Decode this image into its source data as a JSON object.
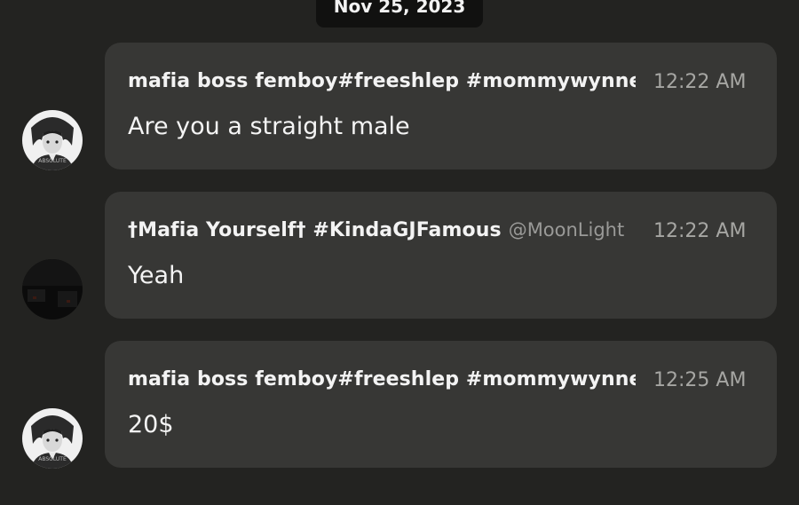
{
  "date_separator": "Nov 25, 2023",
  "messages": [
    {
      "sender": "mafia boss femboy#freeshlep #mommywynne",
      "handle": "",
      "time": "12:22 AM",
      "text": "Are you a straight male",
      "avatar_caption": "ABSOLUTE"
    },
    {
      "sender": "†Mafia Yourself† #KindaGJFamous",
      "handle": "@MoonLight",
      "time": "12:22 AM",
      "text": "Yeah",
      "avatar_caption": ""
    },
    {
      "sender": "mafia boss femboy#freeshlep #mommywynne",
      "handle": "",
      "time": "12:25 AM",
      "text": "20$",
      "avatar_caption": "ABSOLUTE"
    }
  ],
  "colors": {
    "background": "#232321",
    "bubble": "#373735",
    "date_pill": "#111110",
    "text_primary": "#f3f3f3",
    "text_secondary": "#a6a6a3"
  }
}
